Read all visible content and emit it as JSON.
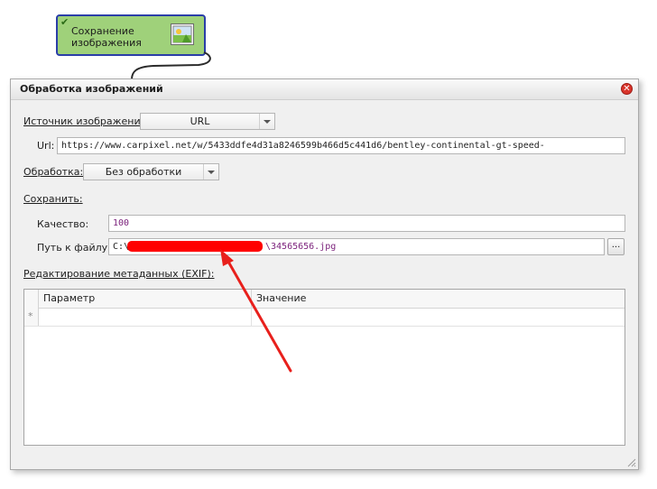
{
  "node": {
    "title_line1": "Сохранение",
    "title_line2": "изображения",
    "check_icon": "checkmark-icon",
    "image_icon": "image-icon"
  },
  "dialog": {
    "title": "Обработка изображений",
    "close_icon": "close-icon",
    "close_glyph": "✕",
    "source_label": "Источник изображения:",
    "source_value": "URL",
    "url_label": "Url:",
    "url_value": "https://www.carpixel.net/w/5433ddfe4d31a8246599b466d5c441d6/bentley-continental-gt-speed-",
    "processing_label": "Обработка:",
    "processing_value": "Без обработки",
    "save_label": "Сохранить:",
    "quality_label": "Качество:",
    "quality_value": "100",
    "filepath_label": "Путь к файлу:",
    "filepath_prefix": "C:\\",
    "filepath_suffix": "\\34565656.jpg",
    "browse_label": "...",
    "metadata_label": "Редактирование метаданных (EXIF):",
    "grid": {
      "columns": [
        "Параметр",
        "Значение"
      ],
      "new_row_marker": "*"
    }
  },
  "colors": {
    "node_fill": "#9fd17a",
    "node_border": "#2a3ea8",
    "annotation_arrow": "#e8201c",
    "redaction": "#ff0000",
    "value_text": "#7a1f7a"
  }
}
